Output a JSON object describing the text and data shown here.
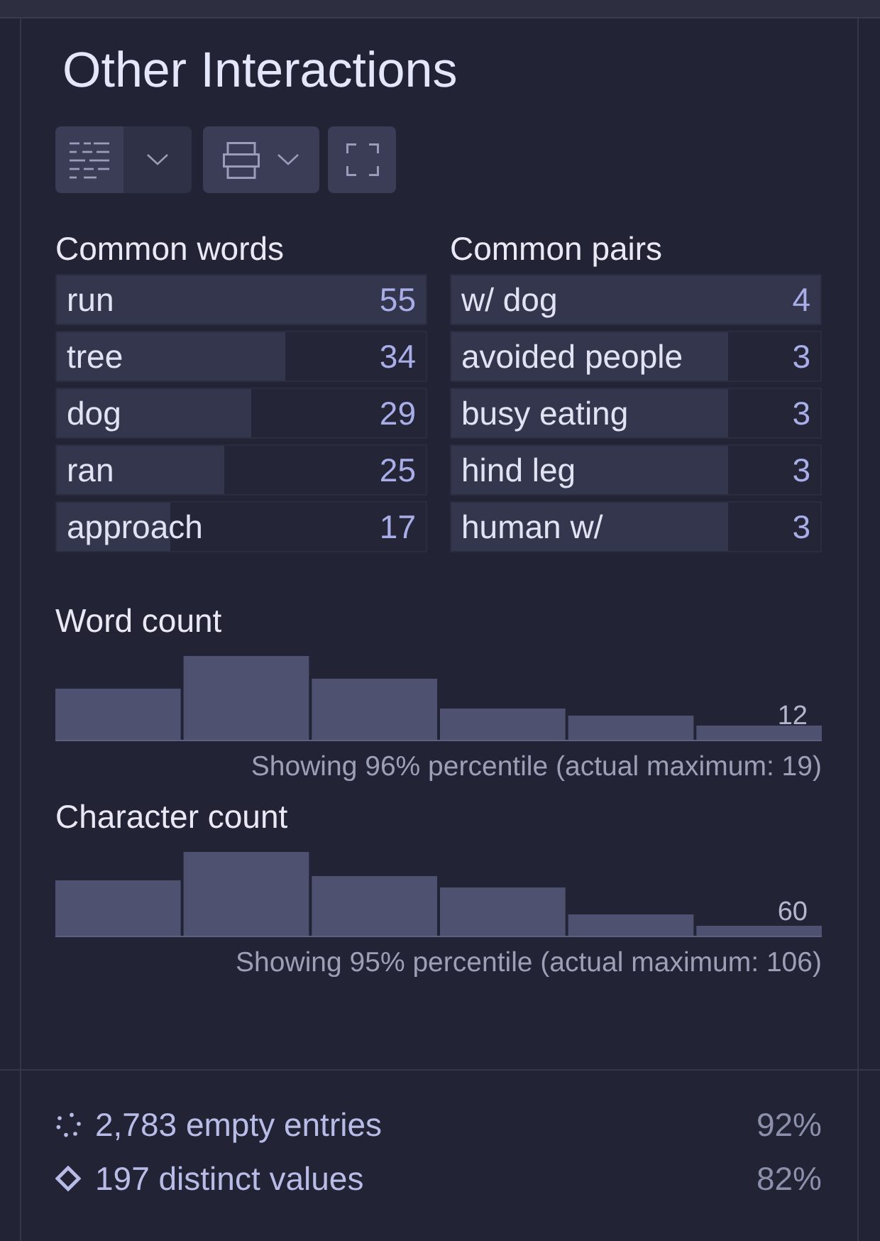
{
  "panel": {
    "title": "Other Interactions"
  },
  "common_words": {
    "title": "Common words",
    "rows": [
      {
        "label": "run",
        "count": "55",
        "level": 1
      },
      {
        "label": "tree",
        "count": "34",
        "level": 0.618
      },
      {
        "label": "dog",
        "count": "29",
        "level": 0.527
      },
      {
        "label": "ran",
        "count": "25",
        "level": 0.455
      },
      {
        "label": "approach",
        "count": "17",
        "level": 0.309
      }
    ]
  },
  "common_pairs": {
    "title": "Common pairs",
    "rows": [
      {
        "label": "w/ dog",
        "count": "4",
        "level": 1
      },
      {
        "label": "avoided people",
        "count": "3",
        "level": 0.75
      },
      {
        "label": "busy eating",
        "count": "3",
        "level": 0.75
      },
      {
        "label": "hind leg",
        "count": "3",
        "level": 0.75
      },
      {
        "label": "human w/",
        "count": "3",
        "level": 0.75
      }
    ]
  },
  "histograms": [
    {
      "title": "Word count",
      "bar_label": "12",
      "caption": "Showing 96% percentile (actual maximum: 19)"
    },
    {
      "title": "Character count",
      "bar_label": "60",
      "caption": "Showing 95% percentile (actual maximum: 106)"
    }
  ],
  "stats": [
    {
      "kind": "empty",
      "text": "2,783 empty entries",
      "percent": "92%"
    },
    {
      "kind": "distinct",
      "text": "197 distinct values",
      "percent": "82%"
    }
  ]
}
